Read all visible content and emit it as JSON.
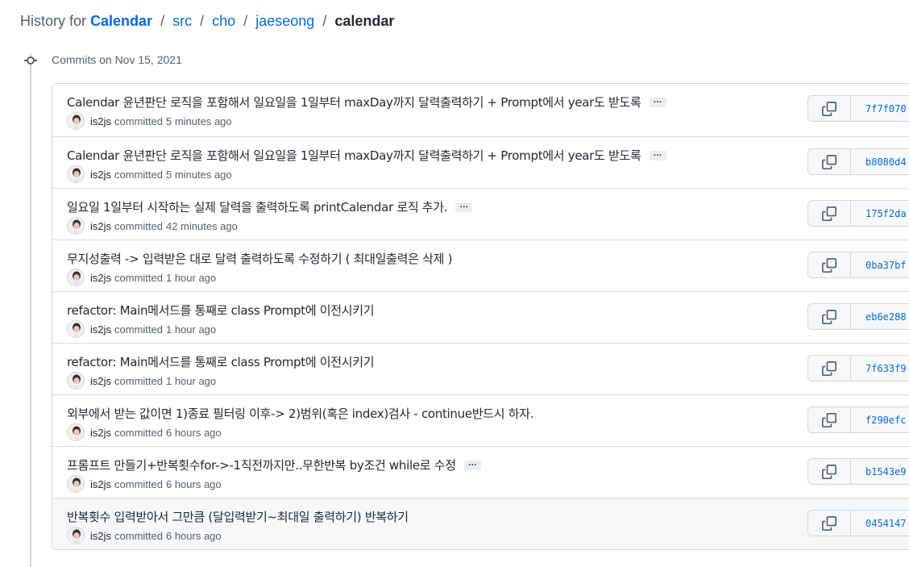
{
  "breadcrumb": {
    "prefix": "History for",
    "repo": "Calendar",
    "path": [
      "src",
      "cho",
      "jaeseong"
    ],
    "current": "calendar",
    "separator": "/"
  },
  "group": {
    "title": "Commits on Nov 15, 2021"
  },
  "commits": [
    {
      "message": "Calendar 윤년판단 로직을 포함해서 일요일을 1일부터 maxDay까지 달력출력하기 + Prompt에서 year도 받도록",
      "has_more": true,
      "author": "is2js",
      "verb": "committed",
      "time": "5 minutes ago",
      "sha": "7f7f070"
    },
    {
      "message": "Calendar 윤년판단 로직을 포함해서 일요일을 1일부터 maxDay까지 달력출력하기 + Prompt에서 year도 받도록",
      "has_more": true,
      "author": "is2js",
      "verb": "committed",
      "time": "5 minutes ago",
      "sha": "b8080d4"
    },
    {
      "message": "일요일 1일부터 시작하는 실제 달력을 출력하도록 printCalendar 로직 추가.",
      "has_more": true,
      "author": "is2js",
      "verb": "committed",
      "time": "42 minutes ago",
      "sha": "175f2da"
    },
    {
      "message": "무지성출력 -> 입력받은 대로 달력 출력하도록 수정하기 ( 최대일출력은 삭제 )",
      "has_more": false,
      "author": "is2js",
      "verb": "committed",
      "time": "1 hour ago",
      "sha": "0ba37bf"
    },
    {
      "message": "refactor: Main메서드를 통째로 class Prompt에 이전시키기",
      "has_more": false,
      "author": "is2js",
      "verb": "committed",
      "time": "1 hour ago",
      "sha": "eb6e288"
    },
    {
      "message": "refactor: Main메서드를 통째로 class Prompt에 이전시키기",
      "has_more": false,
      "author": "is2js",
      "verb": "committed",
      "time": "1 hour ago",
      "sha": "7f633f9"
    },
    {
      "message": "외부에서 받는 값이면 1)종료 필터링 이후-> 2)범위(혹은 index)검사 - continue반드시 하자.",
      "has_more": false,
      "author": "is2js",
      "verb": "committed",
      "time": "6 hours ago",
      "sha": "f290efc"
    },
    {
      "message": "프롬프트 만들기+반복횟수for->-1직전까지만..무한반복 by조건 while로 수정",
      "has_more": true,
      "author": "is2js",
      "verb": "committed",
      "time": "6 hours ago",
      "sha": "b1543e9"
    },
    {
      "message": "반복횟수 입력받아서 그만큼 (달입력받기~최대일 출력하기) 반복하기",
      "has_more": false,
      "author": "is2js",
      "verb": "committed",
      "time": "6 hours ago",
      "sha": "0454147",
      "highlighted": true
    }
  ],
  "icons": {
    "timeline": "git-commit-icon",
    "copy": "copy-icon",
    "more": "ellipsis-icon"
  },
  "colors": {
    "link": "#0969da",
    "muted": "#57606a",
    "border": "#d0d7de"
  },
  "ellipsis_label": "…"
}
